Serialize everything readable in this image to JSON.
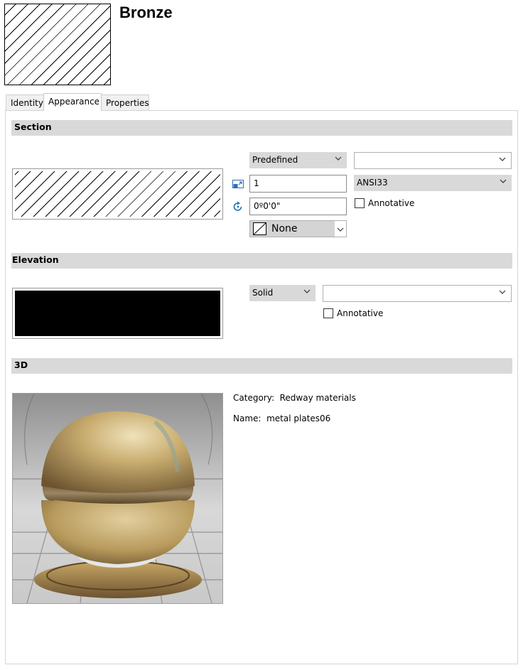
{
  "title": "Bronze",
  "tabs": [
    {
      "label": "Identity"
    },
    {
      "label": "Appearance"
    },
    {
      "label": "Properties"
    }
  ],
  "active_tab": "Appearance",
  "section": {
    "header": "Section",
    "pattern_type": "Predefined",
    "pattern_name_top": "",
    "scale": "1",
    "pattern_name": "ANSI33",
    "angle": "0º0'0\"",
    "annotative_label": "Annotative",
    "annotative_checked": false,
    "background_label": "None"
  },
  "elevation": {
    "header": "Elevation",
    "pattern_type": "Solid",
    "color_value": "",
    "annotative_label": "Annotative",
    "annotative_checked": false,
    "swatch_color": "#000000"
  },
  "threeD": {
    "header": "3D",
    "category_label": "Category:",
    "category_value": "Redway materials",
    "name_label": "Name:",
    "name_value": "metal plates06"
  },
  "icons": [
    "scale-icon",
    "rotate-icon",
    "chevron-down-icon",
    "hatch-swatch-icon"
  ]
}
